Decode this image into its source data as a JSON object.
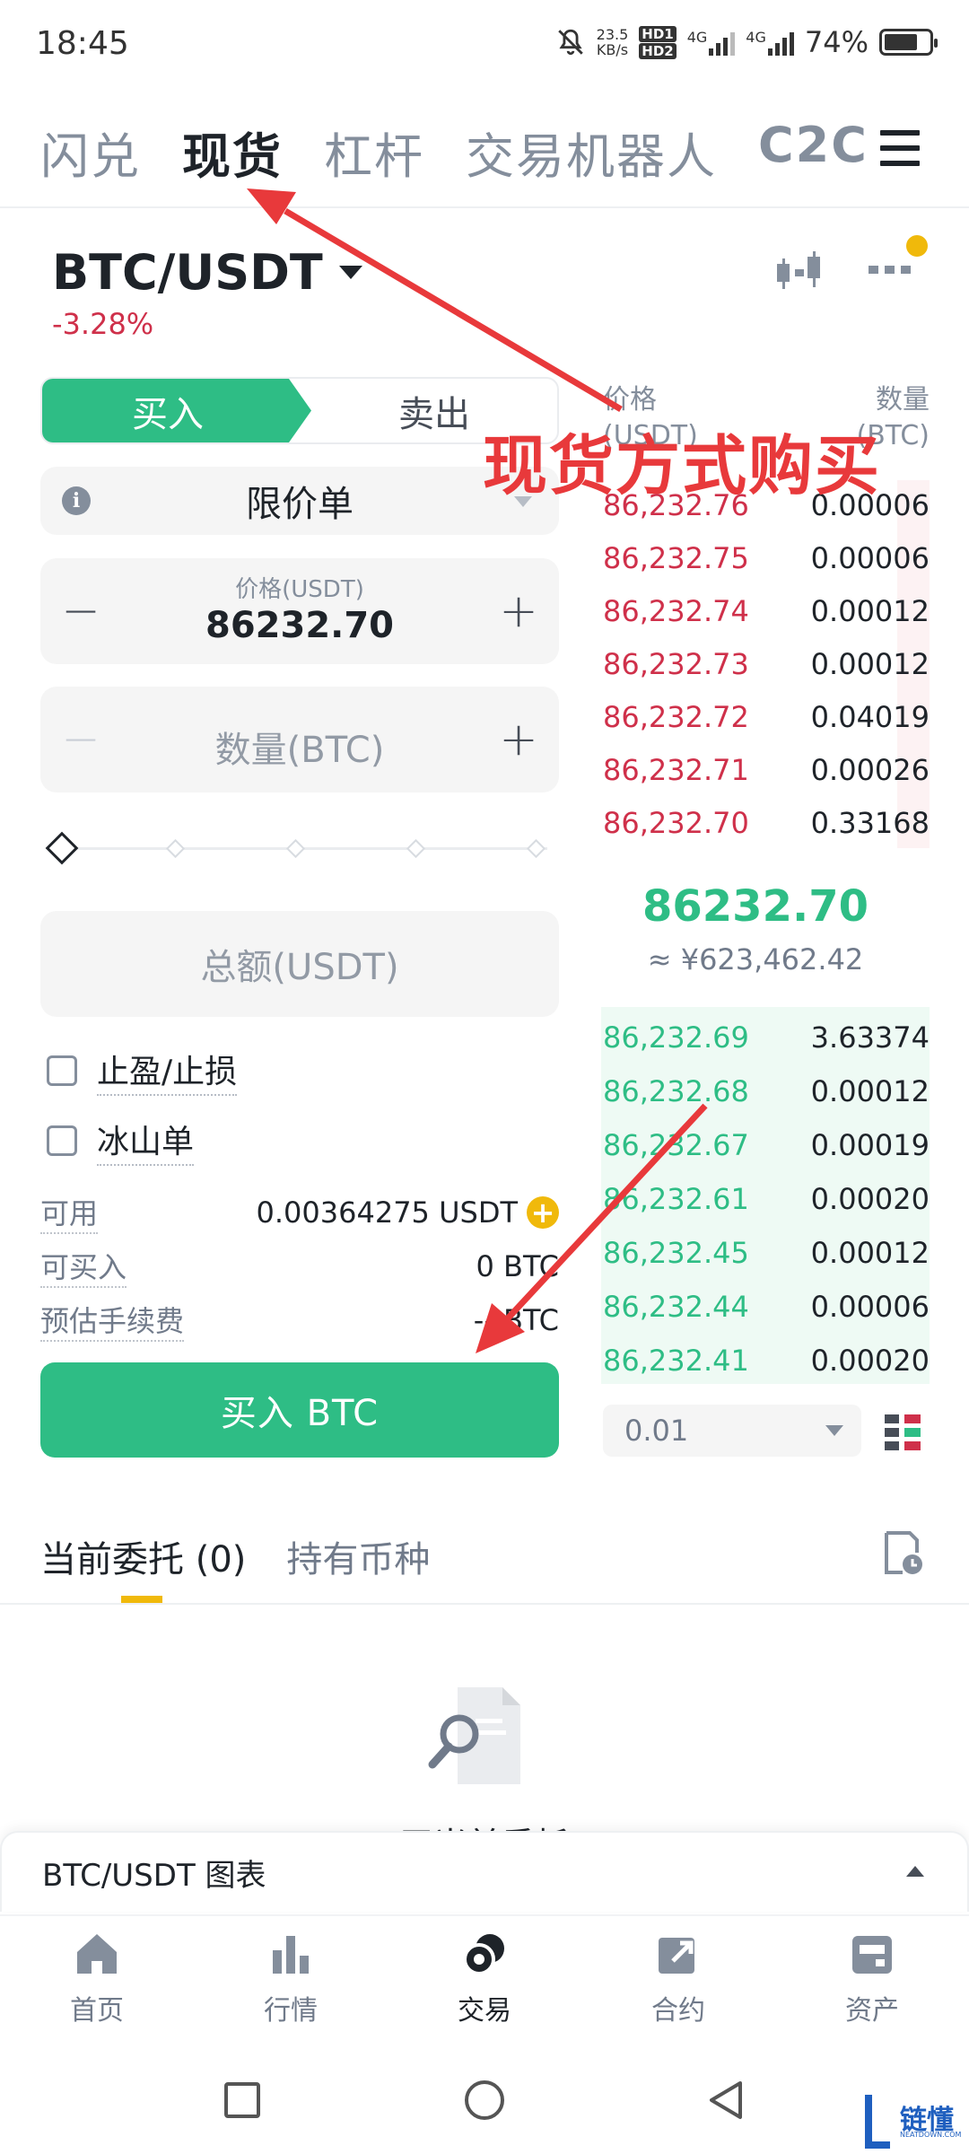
{
  "status_bar": {
    "time": "18:45",
    "net_speed_top": "23.5",
    "net_speed_bottom": "KB/s",
    "hd1": "HD1",
    "hd2": "HD2",
    "net1": "4G",
    "net2": "4G",
    "battery": "74%",
    "battery_level": 0.74
  },
  "top_tabs": [
    {
      "label": "闪兑",
      "active": false
    },
    {
      "label": "现货",
      "active": true
    },
    {
      "label": "杠杆",
      "active": false
    },
    {
      "label": "交易机器人",
      "active": false
    },
    {
      "label": "C2C",
      "active": false
    }
  ],
  "pair": {
    "symbol": "BTC/USDT",
    "change": "-3.28%"
  },
  "trade_form": {
    "buy_tab": "买入",
    "sell_tab": "卖出",
    "order_type": "限价单",
    "info_glyph": "i",
    "price_label": "价格(USDT)",
    "price_value": "86232.70",
    "minus": "−",
    "plus": "+",
    "qty_placeholder": "数量(BTC)",
    "total_placeholder": "总额(USDT)",
    "tp_sl": "止盈/止损",
    "iceberg": "冰山单",
    "available_label": "可用",
    "available_value": "0.00364275 USDT",
    "buyable_label": "可买入",
    "buyable_value": "0 BTC",
    "fee_label": "预估手续费",
    "fee_value": "-- BTC",
    "buy_button": "买入 BTC",
    "slider_percent": 0
  },
  "order_book": {
    "price_header": "价格",
    "price_unit": "(USDT)",
    "qty_header": "数量",
    "qty_unit": "(BTC)",
    "asks": [
      {
        "price": "86,232.76",
        "qty": "0.00006"
      },
      {
        "price": "86,232.75",
        "qty": "0.00006"
      },
      {
        "price": "86,232.74",
        "qty": "0.00012"
      },
      {
        "price": "86,232.73",
        "qty": "0.00012"
      },
      {
        "price": "86,232.72",
        "qty": "0.04019"
      },
      {
        "price": "86,232.71",
        "qty": "0.00026"
      },
      {
        "price": "86,232.70",
        "qty": "0.33168"
      }
    ],
    "mid_price": "86232.70",
    "mid_fiat": "≈ ¥623,462.42",
    "bids": [
      {
        "price": "86,232.69",
        "qty": "3.63374"
      },
      {
        "price": "86,232.68",
        "qty": "0.00012"
      },
      {
        "price": "86,232.67",
        "qty": "0.00019"
      },
      {
        "price": "86,232.61",
        "qty": "0.00020"
      },
      {
        "price": "86,232.45",
        "qty": "0.00012"
      },
      {
        "price": "86,232.44",
        "qty": "0.00006"
      },
      {
        "price": "86,232.41",
        "qty": "0.00020"
      }
    ],
    "precision": "0.01"
  },
  "orders": {
    "tabs": [
      {
        "label": "当前委托 (0)",
        "active": true
      },
      {
        "label": "持有币种",
        "active": false
      }
    ],
    "empty_text": "无当前委托"
  },
  "chart_bar": {
    "label": "BTC/USDT 图表"
  },
  "bottom_nav": [
    {
      "label": "首页",
      "icon": "home-icon",
      "active": false
    },
    {
      "label": "行情",
      "icon": "markets-icon",
      "active": false
    },
    {
      "label": "交易",
      "icon": "trade-icon",
      "active": true
    },
    {
      "label": "合约",
      "icon": "futures-icon",
      "active": false
    },
    {
      "label": "资产",
      "icon": "wallet-icon",
      "active": false
    }
  ],
  "annotation": {
    "text": "现货方式购买",
    "color": "#e8393b"
  },
  "watermark": {
    "text": "链懂",
    "sub": "NEATDOWN.COM"
  },
  "colors": {
    "buy": "#2ebd85",
    "sell": "#cf304a",
    "accent": "#f0b90b",
    "text": "#1e2329",
    "muted": "#848e9c"
  }
}
